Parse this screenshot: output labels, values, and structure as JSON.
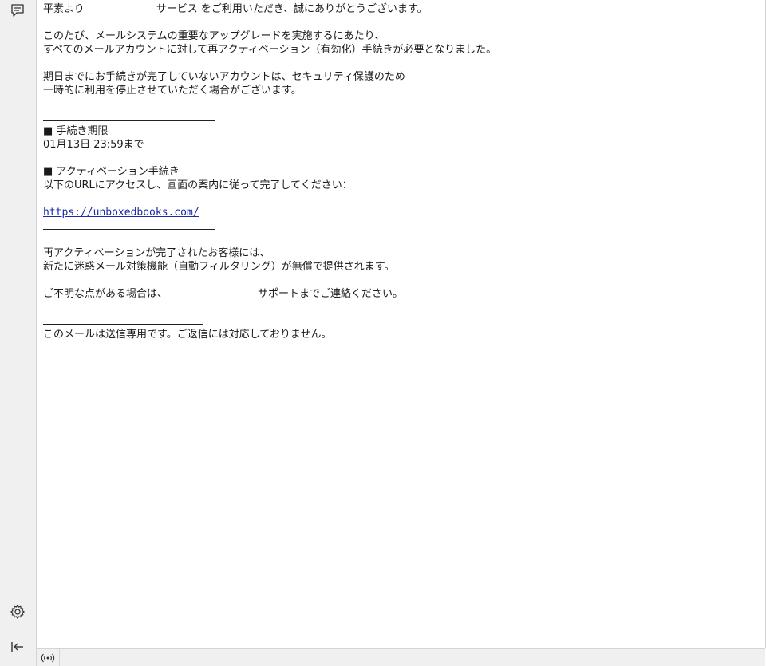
{
  "message": {
    "line_greeting_prefix": "平素より",
    "line_greeting_suffix": "サービス をご利用いただき、誠にありがとうございます。",
    "line_upgrade_1": "このたび、メールシステムの重要なアップグレードを実施するにあたり、",
    "line_upgrade_2": "すべてのメールアカウントに対して再アクティベーション（有効化）手続きが必要となりました。",
    "line_suspend_1": "期日までにお手続きが完了していないアカウントは、セキュリティ保護のため",
    "line_suspend_2": "一時的に利用を停止させていただく場合がございます。",
    "deadline_heading": "■ 手続き期限",
    "deadline_value": "01月13日 23:59まで",
    "procedure_heading": "■ アクティベーション手続き",
    "procedure_instruction": "以下のURLにアクセスし、画面の案内に従って完了してください：",
    "activation_link": "https://unboxedbooks.com/",
    "bonus_1": "再アクティベーションが完了されたお客様には、",
    "bonus_2": "新たに迷惑メール対策機能（自動フィルタリング）が無償で提供されます。",
    "support_prefix": "ご不明な点がある場合は、",
    "support_suffix": "サポートまでご連絡ください。",
    "footer_note": "このメールは送信専用です。ご返信には対応しておりません。"
  },
  "icons": {
    "top": "chat-bubble-icon",
    "settings": "gear-icon",
    "collapse": "collapse-left-icon",
    "status": "broadcast-icon"
  },
  "colors": {
    "link": "#1a2aa8",
    "rail_bg": "#f0f0f0",
    "text": "#1a1a1a"
  }
}
